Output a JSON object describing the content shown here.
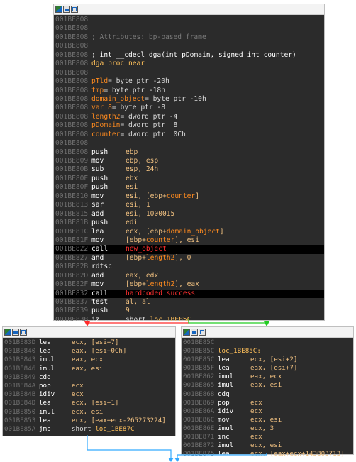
{
  "colors": {
    "node_bg": "#2b2b2b",
    "address": "#6e6e6e",
    "mnemonic": "#ffffff",
    "register": "#f0c080",
    "variable": "#ff8b1f",
    "function_call": "#ff3030",
    "location": "#ffc05a",
    "edge_true": "#ff2a2a",
    "edge_false": "#22cc22",
    "edge_uncond": "#33aaff",
    "highlight_row": "#000000"
  },
  "node_main": {
    "toolbar_icons": [
      "graph-icon",
      "pseudocode-icon",
      "view-icon"
    ],
    "header_lines": [
      {
        "addr": "001BE808",
        "text": ""
      },
      {
        "addr": "001BE808",
        "text": ""
      },
      {
        "addr": "001BE808",
        "text": "; Attributes: bp-based frame",
        "style": "comment"
      },
      {
        "addr": "001BE808",
        "text": ""
      },
      {
        "addr": "001BE808",
        "text": "; int __cdecl dga(int pDomain, signed int counter)",
        "style": "white"
      },
      {
        "addr": "001BE808",
        "text": "dga proc near",
        "style": "gold"
      },
      {
        "addr": "001BE808",
        "text": ""
      }
    ],
    "var_lines": [
      {
        "addr": "001BE808",
        "name": "pTld",
        "def": "= byte ptr -20h"
      },
      {
        "addr": "001BE808",
        "name": "tmp",
        "def": "= byte ptr -18h"
      },
      {
        "addr": "001BE808",
        "name": "domain_object",
        "def": "= byte ptr -10h"
      },
      {
        "addr": "001BE808",
        "name": "var_8",
        "def": "= byte ptr -8"
      },
      {
        "addr": "001BE808",
        "name": "length2",
        "def": "= dword ptr -4"
      },
      {
        "addr": "001BE808",
        "name": "pDomain",
        "def": "= dword ptr  8"
      },
      {
        "addr": "001BE808",
        "name": "counter",
        "def": "= dword ptr  0Ch"
      }
    ],
    "blank_after_vars": {
      "addr": "001BE808"
    },
    "instructions": [
      {
        "addr": "001BE808",
        "mn": "push",
        "ops": [
          [
            "reg",
            "ebp"
          ]
        ]
      },
      {
        "addr": "001BE809",
        "mn": "mov",
        "ops": [
          [
            "reg",
            "ebp, esp"
          ]
        ]
      },
      {
        "addr": "001BE80B",
        "mn": "sub",
        "ops": [
          [
            "reg",
            "esp, 24h"
          ]
        ]
      },
      {
        "addr": "001BE80E",
        "mn": "push",
        "ops": [
          [
            "reg",
            "ebx"
          ]
        ]
      },
      {
        "addr": "001BE80F",
        "mn": "push",
        "ops": [
          [
            "reg",
            "esi"
          ]
        ]
      },
      {
        "addr": "001BE810",
        "mn": "mov",
        "ops": [
          [
            "reg",
            "esi, [ebp+"
          ],
          [
            "var",
            "counter"
          ],
          [
            "reg",
            "]"
          ]
        ]
      },
      {
        "addr": "001BE813",
        "mn": "sar",
        "ops": [
          [
            "reg",
            "esi, 1"
          ]
        ]
      },
      {
        "addr": "001BE815",
        "mn": "add",
        "ops": [
          [
            "reg",
            "esi, 1000015"
          ]
        ]
      },
      {
        "addr": "001BE81B",
        "mn": "push",
        "ops": [
          [
            "reg",
            "edi"
          ]
        ]
      },
      {
        "addr": "001BE81C",
        "mn": "lea",
        "ops": [
          [
            "reg",
            "ecx, [ebp+"
          ],
          [
            "var",
            "domain_object"
          ],
          [
            "reg",
            "]"
          ]
        ]
      },
      {
        "addr": "001BE81F",
        "mn": "mov",
        "ops": [
          [
            "reg",
            "[ebp+"
          ],
          [
            "var",
            "counter"
          ],
          [
            "reg",
            "], esi"
          ]
        ]
      },
      {
        "addr": "001BE822",
        "mn": "call",
        "ops": [
          [
            "func",
            "new_object"
          ]
        ],
        "highlight": true
      },
      {
        "addr": "001BE827",
        "mn": "and",
        "ops": [
          [
            "reg",
            "[ebp+"
          ],
          [
            "var",
            "length2"
          ],
          [
            "reg",
            "], 0"
          ]
        ]
      },
      {
        "addr": "001BE82B",
        "mn": "rdtsc",
        "ops": []
      },
      {
        "addr": "001BE82D",
        "mn": "add",
        "ops": [
          [
            "reg",
            "eax, edx"
          ]
        ]
      },
      {
        "addr": "001BE82F",
        "mn": "mov",
        "ops": [
          [
            "reg",
            "[ebp+"
          ],
          [
            "var",
            "length2"
          ],
          [
            "reg",
            "], eax"
          ]
        ]
      },
      {
        "addr": "001BE832",
        "mn": "call",
        "ops": [
          [
            "func",
            "hardcoded_success"
          ]
        ],
        "highlight": true
      },
      {
        "addr": "001BE837",
        "mn": "test",
        "ops": [
          [
            "reg",
            "al, al"
          ]
        ]
      },
      {
        "addr": "001BE839",
        "mn": "push",
        "ops": [
          [
            "reg",
            "9"
          ]
        ]
      },
      {
        "addr": "001BE83B",
        "mn": "jz",
        "ops": [
          [
            "plain",
            "short "
          ],
          [
            "loc",
            "loc_1BE85C"
          ]
        ]
      }
    ]
  },
  "node_left": {
    "toolbar_icons": [
      "graph-icon",
      "pseudocode-icon",
      "view-icon"
    ],
    "instructions": [
      {
        "addr": "001BE83D",
        "mn": "lea",
        "ops": [
          [
            "reg",
            "ecx, [esi+7]"
          ]
        ]
      },
      {
        "addr": "001BE840",
        "mn": "lea",
        "ops": [
          [
            "reg",
            "eax, [esi+0Ch]"
          ]
        ]
      },
      {
        "addr": "001BE843",
        "mn": "imul",
        "ops": [
          [
            "reg",
            "eax, ecx"
          ]
        ]
      },
      {
        "addr": "001BE846",
        "mn": "imul",
        "ops": [
          [
            "reg",
            "eax, esi"
          ]
        ]
      },
      {
        "addr": "001BE849",
        "mn": "cdq",
        "ops": []
      },
      {
        "addr": "001BE84A",
        "mn": "pop",
        "ops": [
          [
            "reg",
            "ecx"
          ]
        ]
      },
      {
        "addr": "001BE84B",
        "mn": "idiv",
        "ops": [
          [
            "reg",
            "ecx"
          ]
        ]
      },
      {
        "addr": "001BE84D",
        "mn": "lea",
        "ops": [
          [
            "reg",
            "ecx, [esi+1]"
          ]
        ]
      },
      {
        "addr": "001BE850",
        "mn": "imul",
        "ops": [
          [
            "reg",
            "ecx, esi"
          ]
        ]
      },
      {
        "addr": "001BE853",
        "mn": "lea",
        "ops": [
          [
            "reg",
            "ecx, [eax+ecx-265273224]"
          ]
        ]
      },
      {
        "addr": "001BE85A",
        "mn": "jmp",
        "ops": [
          [
            "plain",
            "short "
          ],
          [
            "loc",
            "loc_1BE87C"
          ]
        ]
      }
    ]
  },
  "node_right": {
    "toolbar_icons": [
      "graph-icon",
      "pseudocode-icon",
      "view-icon"
    ],
    "lines": [
      {
        "addr": "001BE85C",
        "label": ""
      },
      {
        "addr": "001BE85C",
        "label": "loc_1BE85C:"
      }
    ],
    "instructions": [
      {
        "addr": "001BE85C",
        "mn": "lea",
        "ops": [
          [
            "reg",
            "ecx, [esi+2]"
          ]
        ]
      },
      {
        "addr": "001BE85F",
        "mn": "lea",
        "ops": [
          [
            "reg",
            "eax, [esi+7]"
          ]
        ]
      },
      {
        "addr": "001BE862",
        "mn": "imul",
        "ops": [
          [
            "reg",
            "eax, ecx"
          ]
        ]
      },
      {
        "addr": "001BE865",
        "mn": "imul",
        "ops": [
          [
            "reg",
            "eax, esi"
          ]
        ]
      },
      {
        "addr": "001BE868",
        "mn": "cdq",
        "ops": []
      },
      {
        "addr": "001BE869",
        "mn": "pop",
        "ops": [
          [
            "reg",
            "ecx"
          ]
        ]
      },
      {
        "addr": "001BE86A",
        "mn": "idiv",
        "ops": [
          [
            "reg",
            "ecx"
          ]
        ]
      },
      {
        "addr": "001BE86C",
        "mn": "mov",
        "ops": [
          [
            "reg",
            "ecx, esi"
          ]
        ]
      },
      {
        "addr": "001BE86E",
        "mn": "imul",
        "ops": [
          [
            "reg",
            "ecx, 3"
          ]
        ]
      },
      {
        "addr": "001BE871",
        "mn": "inc",
        "ops": [
          [
            "reg",
            "ecx"
          ]
        ]
      },
      {
        "addr": "001BE872",
        "mn": "imul",
        "ops": [
          [
            "reg",
            "ecx, esi"
          ]
        ]
      },
      {
        "addr": "001BE875",
        "mn": "lea",
        "ops": [
          [
            "reg",
            "ecx, [eax+ecx+143803713]"
          ]
        ]
      }
    ]
  }
}
